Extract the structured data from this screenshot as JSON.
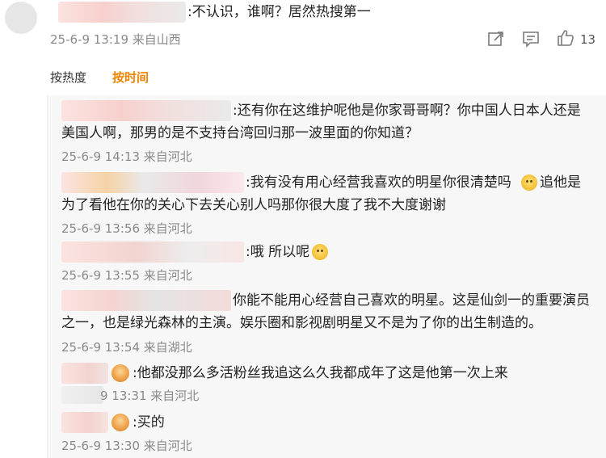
{
  "top_comment": {
    "text": ":不认识，谁啊？居然热搜第一",
    "meta": "25-6-9 13:19 来自山西",
    "like_count": "13",
    "icons": [
      "share-icon",
      "comment-icon",
      "like-icon"
    ]
  },
  "sort_tabs": {
    "hot": "按热度",
    "time": "按时间"
  },
  "replies": [
    {
      "line1": ":还有你在这维护呢他是你家哥哥啊？你中国人日本人还是",
      "line2": "美国人啊，那男的是不支持台湾回归那一波里面的你知道？",
      "meta": "25-6-9 14:13 来自河北"
    },
    {
      "line1a": ":我有没有用心经营我喜欢的明星你很清楚吗",
      "line1b": "追他是",
      "line2": "为了看他在你的关心下去关心别人吗那你很大度了我不大度谢谢",
      "meta": "25-6-9 13:56 来自河北"
    },
    {
      "line1": ":哦 所以呢",
      "meta": "25-6-9 13:55 来自河北"
    },
    {
      "line1": "你能不能用心经营自己喜欢的明星。这是仙剑一的重要演员",
      "line2": "之一，也是绿光森林的主演。娱乐圈和影视剧明星又不是为了你的出生制造的。",
      "meta": "25-6-9 13:54 来自湖北"
    },
    {
      "line1": ":他都没那么多活粉丝我追这么久我都成年了这是他第一次上来",
      "meta": "9 13:31 来自河北"
    },
    {
      "line1": ":买的",
      "meta": "25-6-9 13:30 来自河北"
    }
  ]
}
